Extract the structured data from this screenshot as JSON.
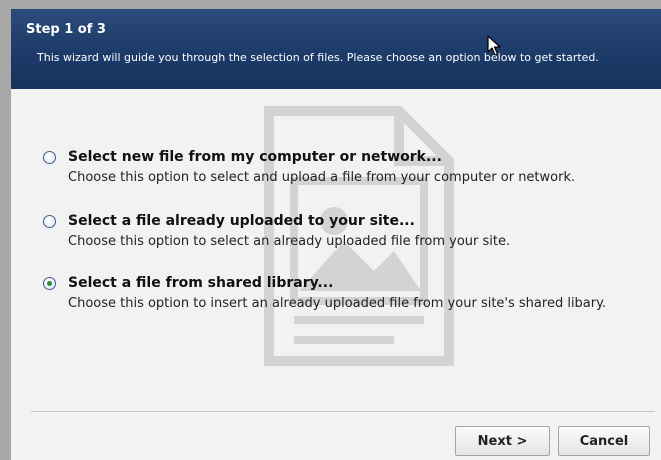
{
  "wizard": {
    "step_title": "Step 1 of 3",
    "description": "This wizard will guide you through the selection of files. Please choose an option below to get started."
  },
  "options": [
    {
      "title": "Select new file from my computer or network...",
      "description": "Choose this option to select and upload a file from your computer or network.",
      "checked": false
    },
    {
      "title": "Select a file already uploaded to your site...",
      "description": "Choose this option to select an already uploaded file from your site.",
      "checked": false
    },
    {
      "title": "Select a file from shared library...",
      "description": "Choose this option to insert an already uploaded file from your site's shared libary.",
      "checked": true
    }
  ],
  "buttons": {
    "next_label": "Next >",
    "cancel_label": "Cancel"
  },
  "colors": {
    "header_bg": "#1c3a68",
    "radio_checked": "#2f8a2f"
  }
}
